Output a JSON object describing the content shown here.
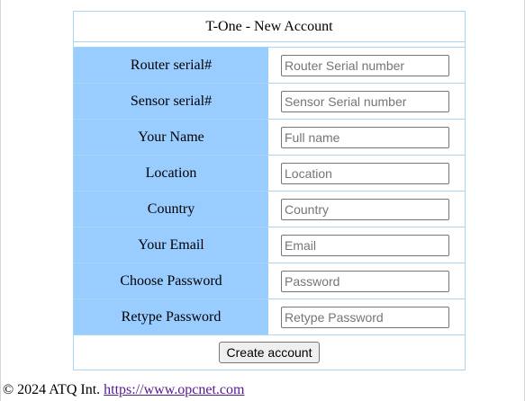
{
  "form": {
    "title": "T-One - New Account",
    "fields": [
      {
        "label": "Router serial#",
        "placeholder": "Router Serial number"
      },
      {
        "label": "Sensor serial#",
        "placeholder": "Sensor Serial number"
      },
      {
        "label": "Your Name",
        "placeholder": "Full name"
      },
      {
        "label": "Location",
        "placeholder": "Location"
      },
      {
        "label": "Country",
        "placeholder": "Country"
      },
      {
        "label": "Your Email",
        "placeholder": "Email"
      },
      {
        "label": "Choose Password",
        "placeholder": "Password"
      },
      {
        "label": "Retype Password",
        "placeholder": "Retype Password"
      }
    ],
    "submit_label": "Create account"
  },
  "footer": {
    "copyright": "© 2024 ATQ Int.",
    "link_text": "https://www.opcnet.com"
  },
  "colors": {
    "label_background": "#99ccff",
    "table_border": "#a9d6f5",
    "link": "#551a8b"
  }
}
